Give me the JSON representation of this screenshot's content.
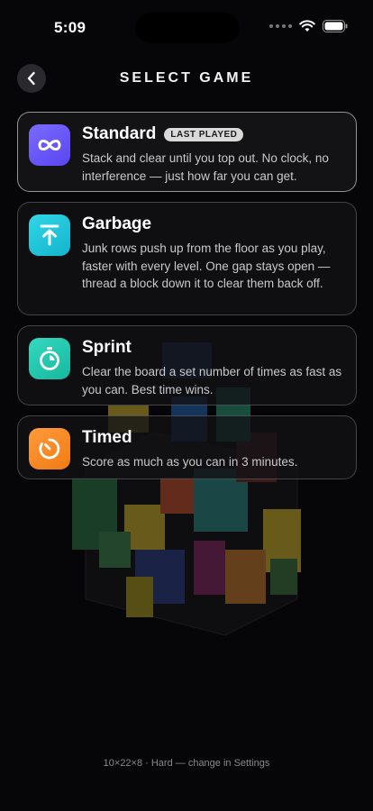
{
  "status_bar": {
    "time": "5:09"
  },
  "header": {
    "title": "SELECT GAME"
  },
  "modes": [
    {
      "name": "Standard",
      "badge": "LAST PLAYED",
      "description": "Stack and clear until you top out. No clock, no interference — just how far you can get.",
      "icon": "infinity-icon",
      "color": "#6f5bff"
    },
    {
      "name": "Garbage",
      "description": "Junk rows push up from the floor as you play, faster with every level. One gap stays open — thread a block down it to clear them back off.",
      "icon": "arrow-up-to-line-icon",
      "color": "#1ec9db"
    },
    {
      "name": "Sprint",
      "description": "Clear the board a set number of times as fast as you can. Best time wins.",
      "icon": "stopwatch-icon",
      "color": "#22cbb3"
    },
    {
      "name": "Timed",
      "description": "Score as much as you can in 3 minutes.",
      "icon": "timer-icon",
      "color": "#ff8a24"
    }
  ],
  "footer": {
    "text": "10×22×8 · Hard — change in Settings"
  },
  "colors": {
    "background": "#060608",
    "card_border": "#ffffff"
  }
}
